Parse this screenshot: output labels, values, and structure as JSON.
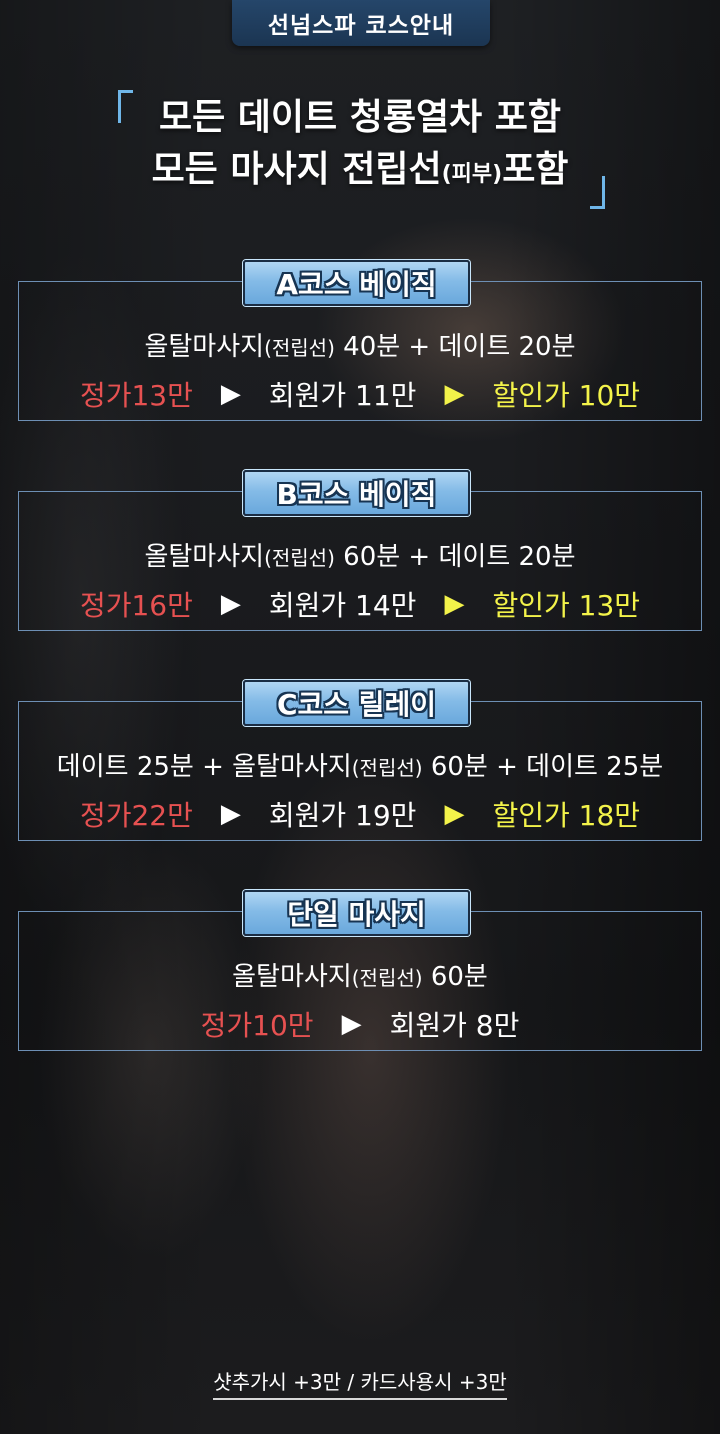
{
  "header": {
    "tab_label": "선넘스파 코스안내",
    "headline_line1": "모든 데이트 청룡열차 포함",
    "headline_line2_main": "모든 마사지 전립선",
    "headline_line2_small": "(피부)",
    "headline_line2_end": "포함"
  },
  "courses": [
    {
      "badge": "A코스 베이직",
      "desc_main": "올탈마사지",
      "desc_paren": "(전립선)",
      "desc_tail": " 40분 + 데이트 20분",
      "regular": "정가13만",
      "member": "회원가 11만",
      "discount": "할인가 10만"
    },
    {
      "badge": "B코스 베이직",
      "desc_main": "올탈마사지",
      "desc_paren": "(전립선)",
      "desc_tail": " 60분 + 데이트 20분",
      "regular": "정가16만",
      "member": "회원가 14만",
      "discount": "할인가 13만"
    },
    {
      "badge": "C코스 릴레이",
      "desc_head": "데이트 25분 + 올탈마사지",
      "desc_paren": "(전립선)",
      "desc_tail": " 60분 + 데이트 25분",
      "regular": "정가22만",
      "member": "회원가 19만",
      "discount": "할인가 18만"
    },
    {
      "badge": "단일 마사지",
      "desc_main": "올탈마사지",
      "desc_paren": "(전립선)",
      "desc_tail": " 60분",
      "regular": "정가10만",
      "member": "회원가 8만"
    }
  ],
  "arrow_glyph": "▶",
  "footer": {
    "note": "샷추가시 +3만 / 카드사용시 +3만"
  },
  "colors": {
    "accent_blue": "#6fb6e8",
    "regular_price": "#e65151",
    "discount_price": "#f3f34a",
    "tab_bg": "#25466a"
  }
}
